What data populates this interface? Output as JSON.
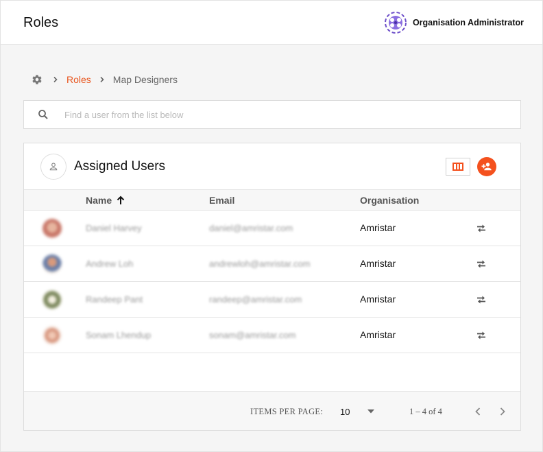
{
  "header": {
    "title": "Roles",
    "org_name": "Organisation Administrator",
    "brand_color": "#6d4fc9"
  },
  "breadcrumb": {
    "home_icon": "gear-icon",
    "link": "Roles",
    "current": "Map Designers"
  },
  "search": {
    "placeholder": "Find a user from the list below",
    "value": ""
  },
  "card": {
    "title": "Assigned Users",
    "columns_icon": "view-columns-icon",
    "add_icon": "person-add-icon",
    "accent_color": "#f4511e"
  },
  "table": {
    "columns": [
      "Name",
      "Email",
      "Organisation"
    ],
    "sort": {
      "column": "Name",
      "direction": "ascending"
    },
    "rows": [
      {
        "name": "Daniel Harvey",
        "email": "daniel@amristar.com",
        "organisation": "Amristar"
      },
      {
        "name": "Andrew Loh",
        "email": "andrewloh@amristar.com",
        "organisation": "Amristar"
      },
      {
        "name": "Randeep Pant",
        "email": "randeep@amristar.com",
        "organisation": "Amristar"
      },
      {
        "name": "Sonam Lhendup",
        "email": "sonam@amristar.com",
        "organisation": "Amristar"
      }
    ]
  },
  "paginator": {
    "items_per_page_label": "ITEMS PER PAGE:",
    "items_per_page": "10",
    "range": "1 – 4 of 4"
  }
}
